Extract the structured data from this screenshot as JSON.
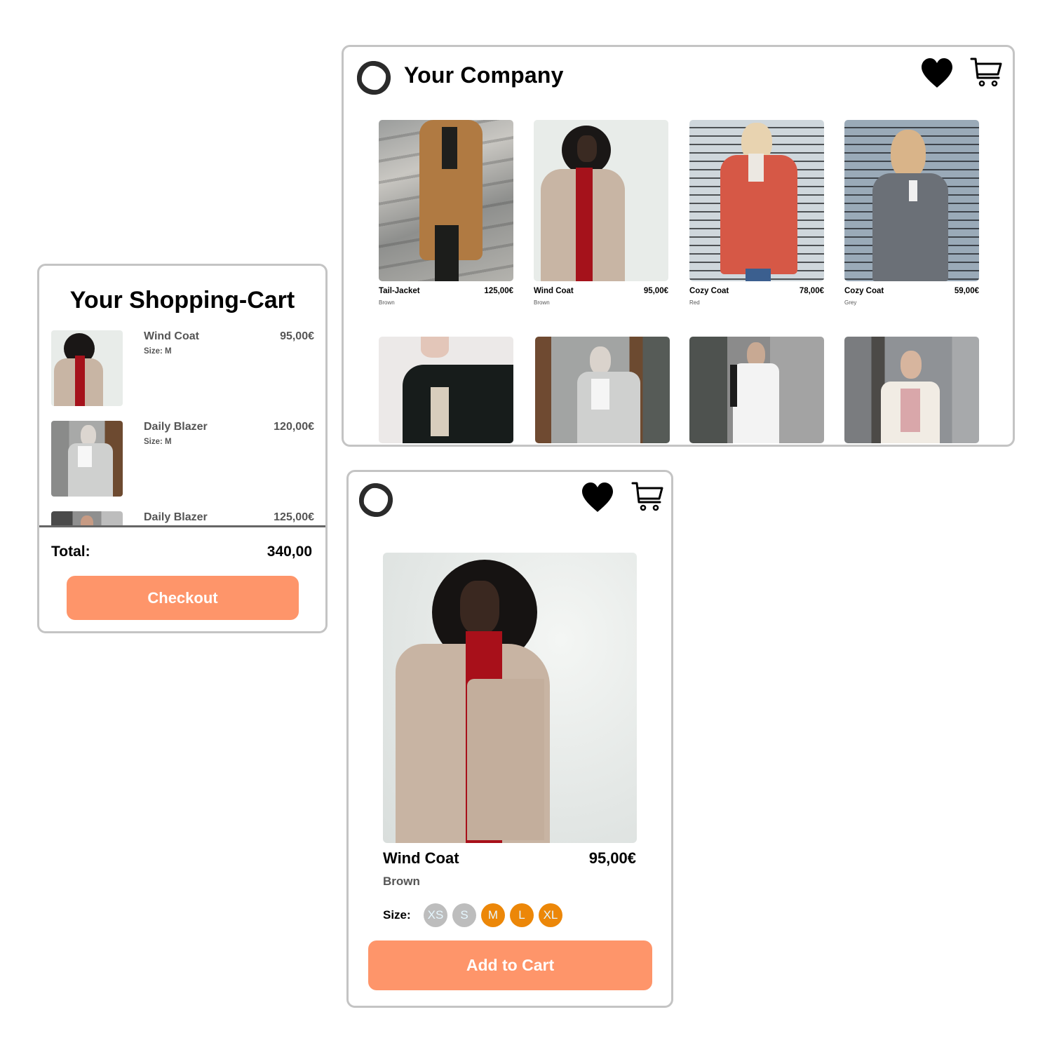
{
  "shop": {
    "brand_name": "Your Company",
    "icons": {
      "logo": "swirl-logo-icon",
      "wishlist": "heart-icon",
      "cart": "shopping-cart-icon"
    },
    "products": [
      {
        "name": "Tail-Jacket",
        "price": "125,00€",
        "color": "Brown",
        "image": "model in camel belted coat on stone steps"
      },
      {
        "name": "Wind Coat",
        "price": "95,00€",
        "color": "Brown",
        "image": "model in beige wrap coat with red dress"
      },
      {
        "name": "Cozy Coat",
        "price": "78,00€",
        "color": "Red",
        "image": "model in red belted hooded coat"
      },
      {
        "name": "Cozy Coat",
        "price": "59,00€",
        "color": "Grey",
        "image": "model in grey belted coat"
      },
      {
        "name": "",
        "price": "",
        "color": "",
        "image": "model in black blazer"
      },
      {
        "name": "",
        "price": "",
        "color": "",
        "image": "model in light grey coat and headscarf"
      },
      {
        "name": "",
        "price": "",
        "color": "",
        "image": "model in white belted jacket"
      },
      {
        "name": "",
        "price": "",
        "color": "",
        "image": "model in cream coat and pink sweater"
      }
    ]
  },
  "cart": {
    "title": "Your Shopping-Cart",
    "items": [
      {
        "name": "Wind Coat",
        "size": "Size: M",
        "price": "95,00€"
      },
      {
        "name": "Daily Blazer",
        "size": "Size: M",
        "price": "120,00€"
      },
      {
        "name": "Daily Blazer",
        "size": "",
        "price": "125,00€"
      }
    ],
    "total_label": "Total:",
    "total_value": "340,00",
    "checkout_label": "Checkout"
  },
  "detail": {
    "icons": {
      "logo": "swirl-logo-icon",
      "wishlist": "heart-icon",
      "cart": "shopping-cart-icon"
    },
    "product_name": "Wind Coat",
    "price": "95,00€",
    "color": "Brown",
    "size_label": "Size:",
    "sizes": [
      {
        "label": "XS",
        "available": false
      },
      {
        "label": "S",
        "available": false
      },
      {
        "label": "M",
        "available": true
      },
      {
        "label": "L",
        "available": true
      },
      {
        "label": "XL",
        "available": true
      }
    ],
    "add_to_cart_label": "Add to Cart"
  },
  "colors": {
    "accent_button": "#fe956a",
    "size_available": "#ec8708",
    "size_unavailable": "#bdbdbd",
    "panel_border": "#c4c4c4"
  }
}
